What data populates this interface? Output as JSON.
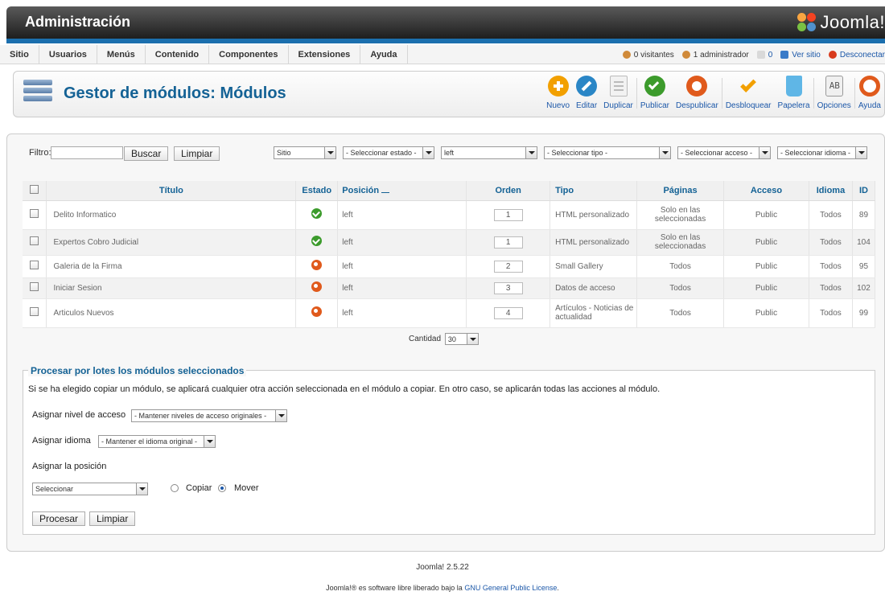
{
  "header": {
    "title": "Administración",
    "logo_text": "Joomla!"
  },
  "menu": [
    "Sitio",
    "Usuarios",
    "Menús",
    "Contenido",
    "Componentes",
    "Extensiones",
    "Ayuda"
  ],
  "status": {
    "visitors": "0 visitantes",
    "admins": "1 administrador",
    "messages": "0",
    "view_site": "Ver sitio",
    "logout": "Desconectar"
  },
  "page": {
    "title": "Gestor de módulos: Módulos"
  },
  "toolbar": [
    {
      "label": "Nuevo",
      "icon": "plus-icon",
      "color": "#f2a000"
    },
    {
      "label": "Editar",
      "icon": "pencil-icon",
      "color": "#2a86c6"
    },
    {
      "label": "Duplicar",
      "icon": "copy-icon",
      "color": "#bfbfbf"
    },
    {
      "label": "Publicar",
      "icon": "check-icon",
      "color": "#3c9b2c"
    },
    {
      "label": "Despublicar",
      "icon": "unpublish-icon",
      "color": "#e05a1c"
    },
    {
      "label": "Desbloquear",
      "icon": "checkin-icon",
      "color": "#f2a000"
    },
    {
      "label": "Papelera",
      "icon": "trash-icon",
      "color": "#5fb6e6"
    },
    {
      "label": "Opciones",
      "icon": "options-icon",
      "color": "#cccccc"
    },
    {
      "label": "Ayuda",
      "icon": "help-icon",
      "color": "#e05a1c"
    }
  ],
  "filter": {
    "label": "Filtro:",
    "search_value": "",
    "search_button": "Buscar",
    "clear_button": "Limpiar",
    "selects": [
      "Sitio",
      "- Seleccionar estado -",
      "left",
      "- Seleccionar tipo -",
      "- Seleccionar acceso -",
      "- Seleccionar idioma -"
    ]
  },
  "table": {
    "columns": [
      "Título",
      "Estado",
      "Posición",
      "Orden",
      "Tipo",
      "Páginas",
      "Acceso",
      "Idioma",
      "ID"
    ],
    "rows": [
      {
        "title": "Delito Informatico",
        "published": true,
        "position": "left",
        "order": "1",
        "type": "HTML personalizado",
        "pages": "Solo en las seleccionadas",
        "access": "Public",
        "language": "Todos",
        "id": "89"
      },
      {
        "title": "Expertos Cobro Judicial",
        "published": true,
        "position": "left",
        "order": "1",
        "type": "HTML personalizado",
        "pages": "Solo en las seleccionadas",
        "access": "Public",
        "language": "Todos",
        "id": "104"
      },
      {
        "title": "Galeria de la Firma",
        "published": false,
        "position": "left",
        "order": "2",
        "type": "Small Gallery",
        "pages": "Todos",
        "access": "Public",
        "language": "Todos",
        "id": "95"
      },
      {
        "title": "Iniciar Sesion",
        "published": false,
        "position": "left",
        "order": "3",
        "type": "Datos de acceso",
        "pages": "Todos",
        "access": "Public",
        "language": "Todos",
        "id": "102"
      },
      {
        "title": "Articulos Nuevos",
        "published": false,
        "position": "left",
        "order": "4",
        "type": "Artículos - Noticias de actualidad",
        "pages": "Todos",
        "access": "Public",
        "language": "Todos",
        "id": "99"
      }
    ],
    "limit_label": "Cantidad",
    "limit_value": "30"
  },
  "batch": {
    "legend": "Procesar por lotes los módulos seleccionados",
    "description": "Si se ha elegido copiar un módulo, se aplicará cualquier otra acción seleccionada en el módulo a copiar. En otro caso, se aplicarán todas las acciones al módulo.",
    "access_label": "Asignar nivel de acceso",
    "access_value": "- Mantener niveles de acceso originales -",
    "language_label": "Asignar idioma",
    "language_value": "- Mantener el idioma original -",
    "position_label": "Asignar la posición",
    "position_value": "Seleccionar",
    "copy_label": "Copiar",
    "move_label": "Mover",
    "move_selected": true,
    "process_button": "Procesar",
    "clear_button": "Limpiar"
  },
  "footer": {
    "version": "Joomla! 2.5.22",
    "license_prefix": "Joomla!® es software libre liberado bajo la ",
    "license_link": "GNU General Public License",
    "license_suffix": "."
  }
}
